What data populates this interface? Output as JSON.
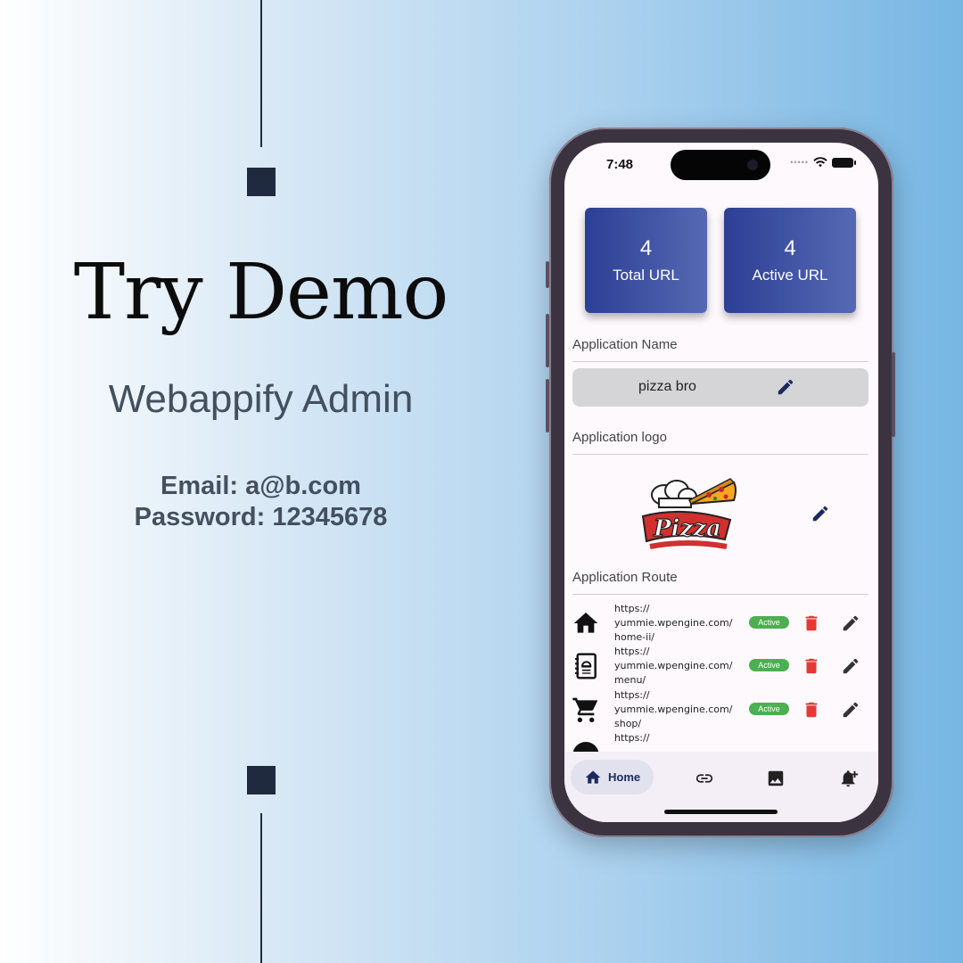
{
  "promo": {
    "title": "Try Demo",
    "subtitle": "Webappify Admin",
    "email_line": "Email: a@b.com",
    "password_line": "Password: 12345678"
  },
  "status_bar": {
    "time": "7:48",
    "icons": [
      "signal-dots-icon",
      "wifi-icon",
      "battery-icon"
    ]
  },
  "stats": [
    {
      "value": "4",
      "label": "Total URL"
    },
    {
      "value": "4",
      "label": "Active URL"
    }
  ],
  "app_name": {
    "section_label": "Application Name",
    "value": "pizza bro",
    "edit_icon": "pencil-icon"
  },
  "app_logo": {
    "section_label": "Application logo",
    "edit_icon": "pencil-icon",
    "logo_text": "Pizza"
  },
  "routes": {
    "section_label": "Application Route",
    "items": [
      {
        "icon": "home-icon",
        "url_lines": [
          "https://",
          "yummie.wpengine.com/",
          "home-ii/"
        ],
        "status": "Active"
      },
      {
        "icon": "menu-book-icon",
        "url_lines": [
          "https://",
          "yummie.wpengine.com/",
          "menu/"
        ],
        "status": "Active"
      },
      {
        "icon": "shopping-cart-icon",
        "url_lines": [
          "https://",
          "yummie.wpengine.com/",
          "shop/"
        ],
        "status": "Active"
      },
      {
        "icon": "circle-icon",
        "url_lines": [
          "https://",
          "",
          ""
        ],
        "status": ""
      }
    ]
  },
  "bottom_nav": {
    "home_label": "Home",
    "items": [
      "home-icon",
      "link-icon",
      "image-icon",
      "notification-add-icon"
    ]
  },
  "colors": {
    "card_gradient_start": "#2c3f95",
    "card_gradient_end": "#5569b3",
    "badge_green": "#4caf50",
    "delete_red": "#e53935",
    "accent_navy": "#1c2a60"
  }
}
